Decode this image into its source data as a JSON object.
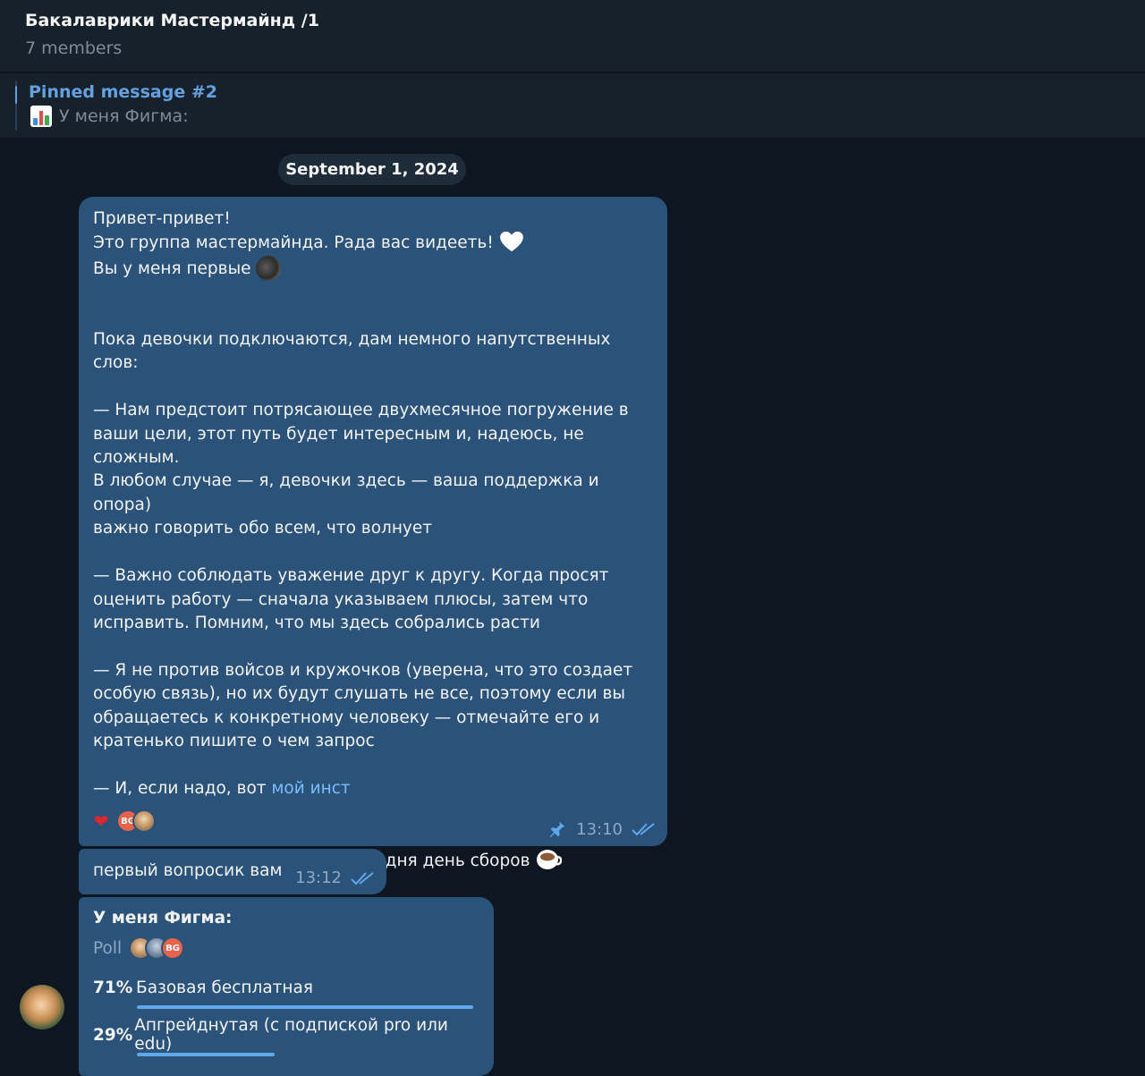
{
  "header": {
    "title": "Бакалаврики Мастермайнд /1",
    "subtitle": "7 members"
  },
  "pinned": {
    "title": "Pinned message #2",
    "text": "У меня Фигма:",
    "icon": "bar-chart-icon"
  },
  "date_separator": "September 1, 2024",
  "messages": [
    {
      "lines": {
        "l1": "Привет-привет!",
        "l2": "Это группа мастермайнда. Рада вас видееть! ",
        "l3": "Вы у меня первые ",
        "p1": "Пока девочки подключаются, дам немного напутственных слов:",
        "p2": "— Нам предстоит потрясающее двухмесячное погружение в\nваши цели, этот путь будет интересным и, надеюсь, не сложным.\nВ любом случае — я, девочки здесь — ваша поддержка и опора)\nважно говорить обо всем, что волнует",
        "p3": "— Важно соблюдать уважение друг к другу. Когда просят\nоценить работу — сначала указываем плюсы, затем что\nисправить. Помним, что мы здесь собрались расти",
        "p4": "— Я не против войсов и кружочков (уверена, что это создает\nособую связь), но их будут слушать не все, поэтому если вы\nобращаетесь к конкретному человеку — отмечайте его и\nкратенько пишите о чем запрос",
        "p5_prefix": "— И, если надо, вот ",
        "p5_link": "мой инст",
        "p6": "Официальный старт завтра, сегодня день сборов "
      },
      "reactions": {
        "emoji": "❤",
        "avatar_initials": "BG"
      },
      "time": "13:10",
      "pinned": true
    },
    {
      "text": "первый вопросик вам",
      "time": "13:12"
    }
  ],
  "poll": {
    "question": "У меня Фигма:",
    "type_label": "Poll",
    "voter_initials": "BG",
    "options": [
      {
        "percent": "71%",
        "label": "Базовая бесплатная",
        "value": 0.71
      },
      {
        "percent": "29%",
        "label": "Апгрейднутая (с подпиской pro или edu)",
        "value": 0.29
      }
    ]
  },
  "colors": {
    "background": "#0e1621",
    "header": "#17212b",
    "bubble_out": "#2b5278",
    "accent": "#63a1e0",
    "link": "#7bbcff"
  }
}
